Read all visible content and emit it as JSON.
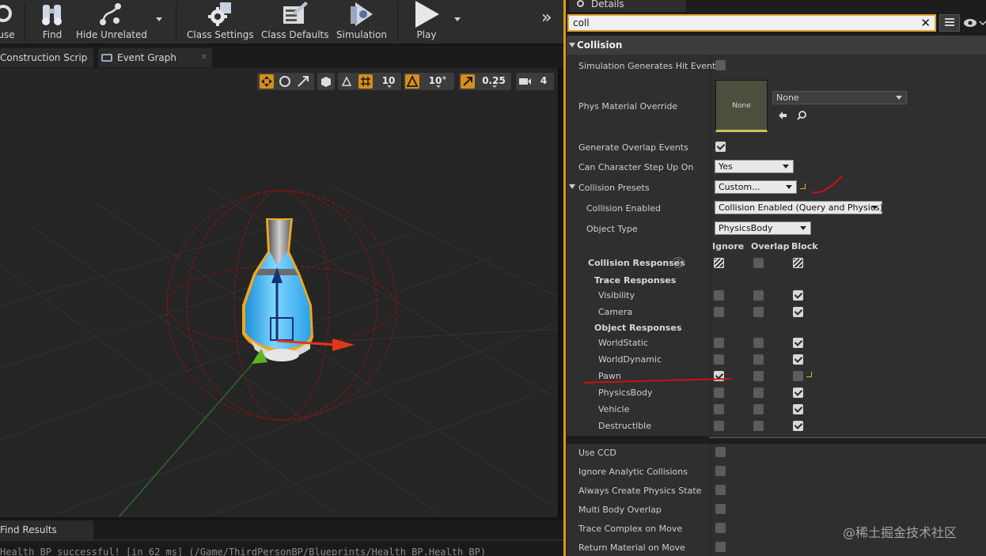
{
  "toolbar": {
    "buttons": [
      {
        "label": "use"
      },
      {
        "label": "Find"
      },
      {
        "label": "Hide Unrelated"
      },
      {
        "label": "Class Settings"
      },
      {
        "label": "Class Defaults"
      },
      {
        "label": "Simulation"
      },
      {
        "label": "Play"
      }
    ],
    "overflow_glyph": "»"
  },
  "tabs": [
    {
      "label": "Construction Scrip"
    },
    {
      "label": "Event Graph"
    }
  ],
  "viewport_toolbar": {
    "grid_snap": "10",
    "rotation_snap": "10°",
    "scale_snap": "0.25",
    "camera_speed": "4"
  },
  "find_results": {
    "tab_label": "Find Results",
    "log_line": "Health_BP successful! [in 62 ms] (/Game/ThirdPersonBP/Blueprints/Health_BP.Health_BP)"
  },
  "details": {
    "tab_label": "Details",
    "search_value": "coll",
    "category": "Collision",
    "rows": {
      "sim_hit": {
        "label": "Simulation Generates Hit Events",
        "checked": false
      },
      "phys_material": {
        "label": "Phys Material Override",
        "thumb": "None",
        "combo": "None"
      },
      "overlap_events": {
        "label": "Generate Overlap Events",
        "checked": true
      },
      "step_up": {
        "label": "Can Character Step Up On",
        "value": "Yes"
      },
      "presets": {
        "label": "Collision Presets",
        "value": "Custom..."
      },
      "enabled": {
        "label": "Collision Enabled",
        "value": "Collision Enabled (Query and Physics)"
      },
      "object_type": {
        "label": "Object Type",
        "value": "PhysicsBody"
      }
    },
    "response_headers": [
      "Ignore",
      "Overlap",
      "Block"
    ],
    "collision_responses_label": "Collision Responses",
    "trace_responses_label": "Trace Responses",
    "object_responses_label": "Object Responses",
    "trace_channels": [
      {
        "label": "Visibility",
        "response": "Block"
      },
      {
        "label": "Camera",
        "response": "Block"
      }
    ],
    "object_channels": [
      {
        "label": "WorldStatic",
        "response": "Block"
      },
      {
        "label": "WorldDynamic",
        "response": "Block"
      },
      {
        "label": "Pawn",
        "response": "Ignore"
      },
      {
        "label": "PhysicsBody",
        "response": "Block"
      },
      {
        "label": "Vehicle",
        "response": "Block"
      },
      {
        "label": "Destructible",
        "response": "Block"
      }
    ],
    "extra_rows": [
      {
        "label": "Use CCD",
        "checked": false
      },
      {
        "label": "Ignore Analytic Collisions",
        "checked": false
      },
      {
        "label": "Always Create Physics State",
        "checked": false
      },
      {
        "label": "Multi Body Overlap",
        "checked": false
      },
      {
        "label": "Trace Complex on Move",
        "checked": false
      },
      {
        "label": "Return Material on Move",
        "checked": false
      }
    ]
  },
  "watermark": "@稀土掘金技术社区",
  "colors": {
    "accent_orange": "#d68e1a",
    "annotation_red": "#cc1111",
    "gizmo_red": "#e0381a",
    "gizmo_blue": "#1e4fc8",
    "gizmo_green": "#5ab520"
  }
}
